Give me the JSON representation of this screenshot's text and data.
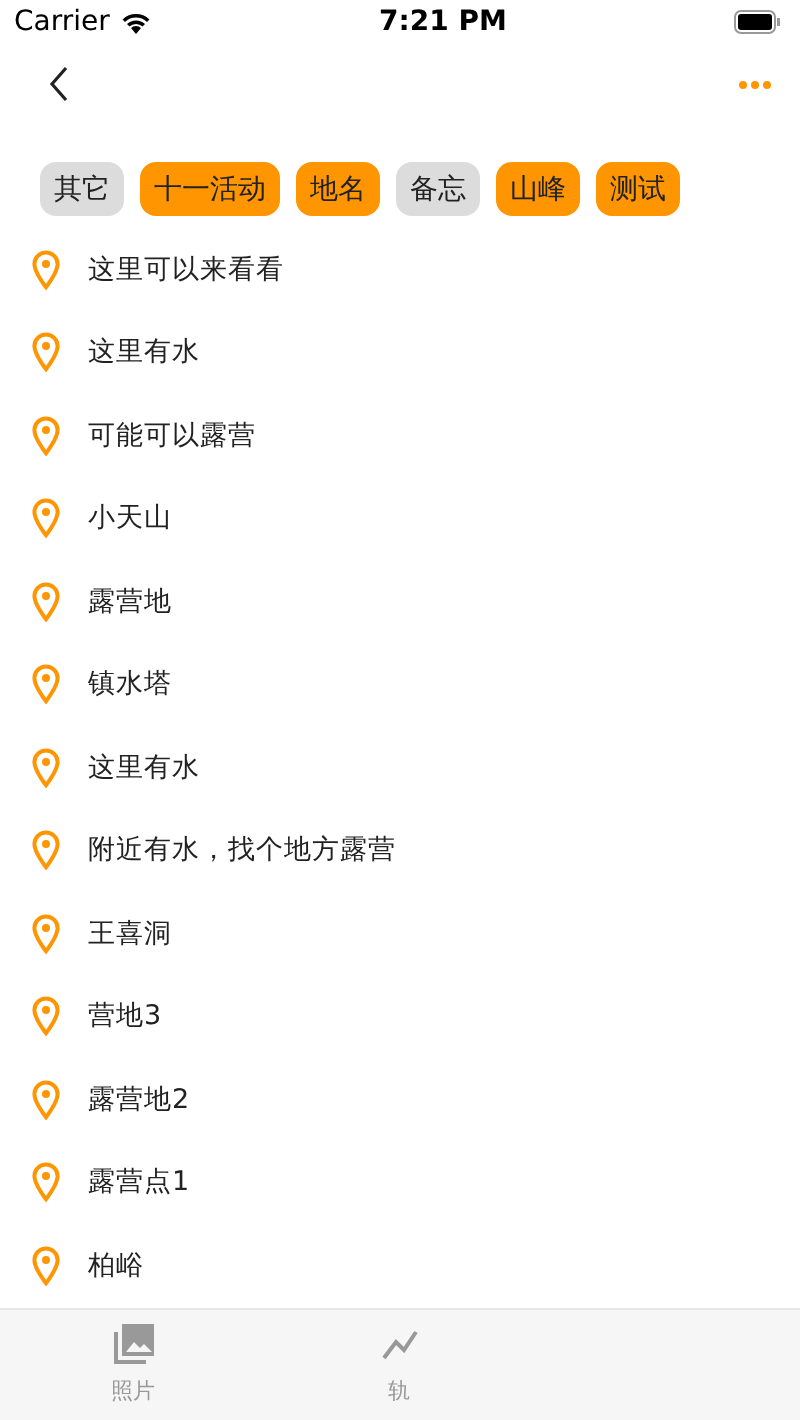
{
  "status_bar": {
    "carrier": "Carrier",
    "time": "7:21 PM"
  },
  "tags": [
    {
      "label": "其它",
      "selected": false
    },
    {
      "label": "十一活动",
      "selected": true
    },
    {
      "label": "地名",
      "selected": true
    },
    {
      "label": "备忘",
      "selected": false
    },
    {
      "label": "山峰",
      "selected": true
    },
    {
      "label": "测试",
      "selected": true
    }
  ],
  "places": [
    "这里可以来看看",
    "这里有水",
    "可能可以露营",
    "小天山",
    "露营地",
    "镇水塔",
    "这里有水",
    "附近有水，找个地方露营",
    "王喜洞",
    "营地3",
    "露营地2",
    "露营点1",
    "柏峪"
  ],
  "tab_bar": [
    {
      "label": "照片",
      "kind": "photo"
    },
    {
      "label": "轨",
      "kind": "track"
    }
  ]
}
